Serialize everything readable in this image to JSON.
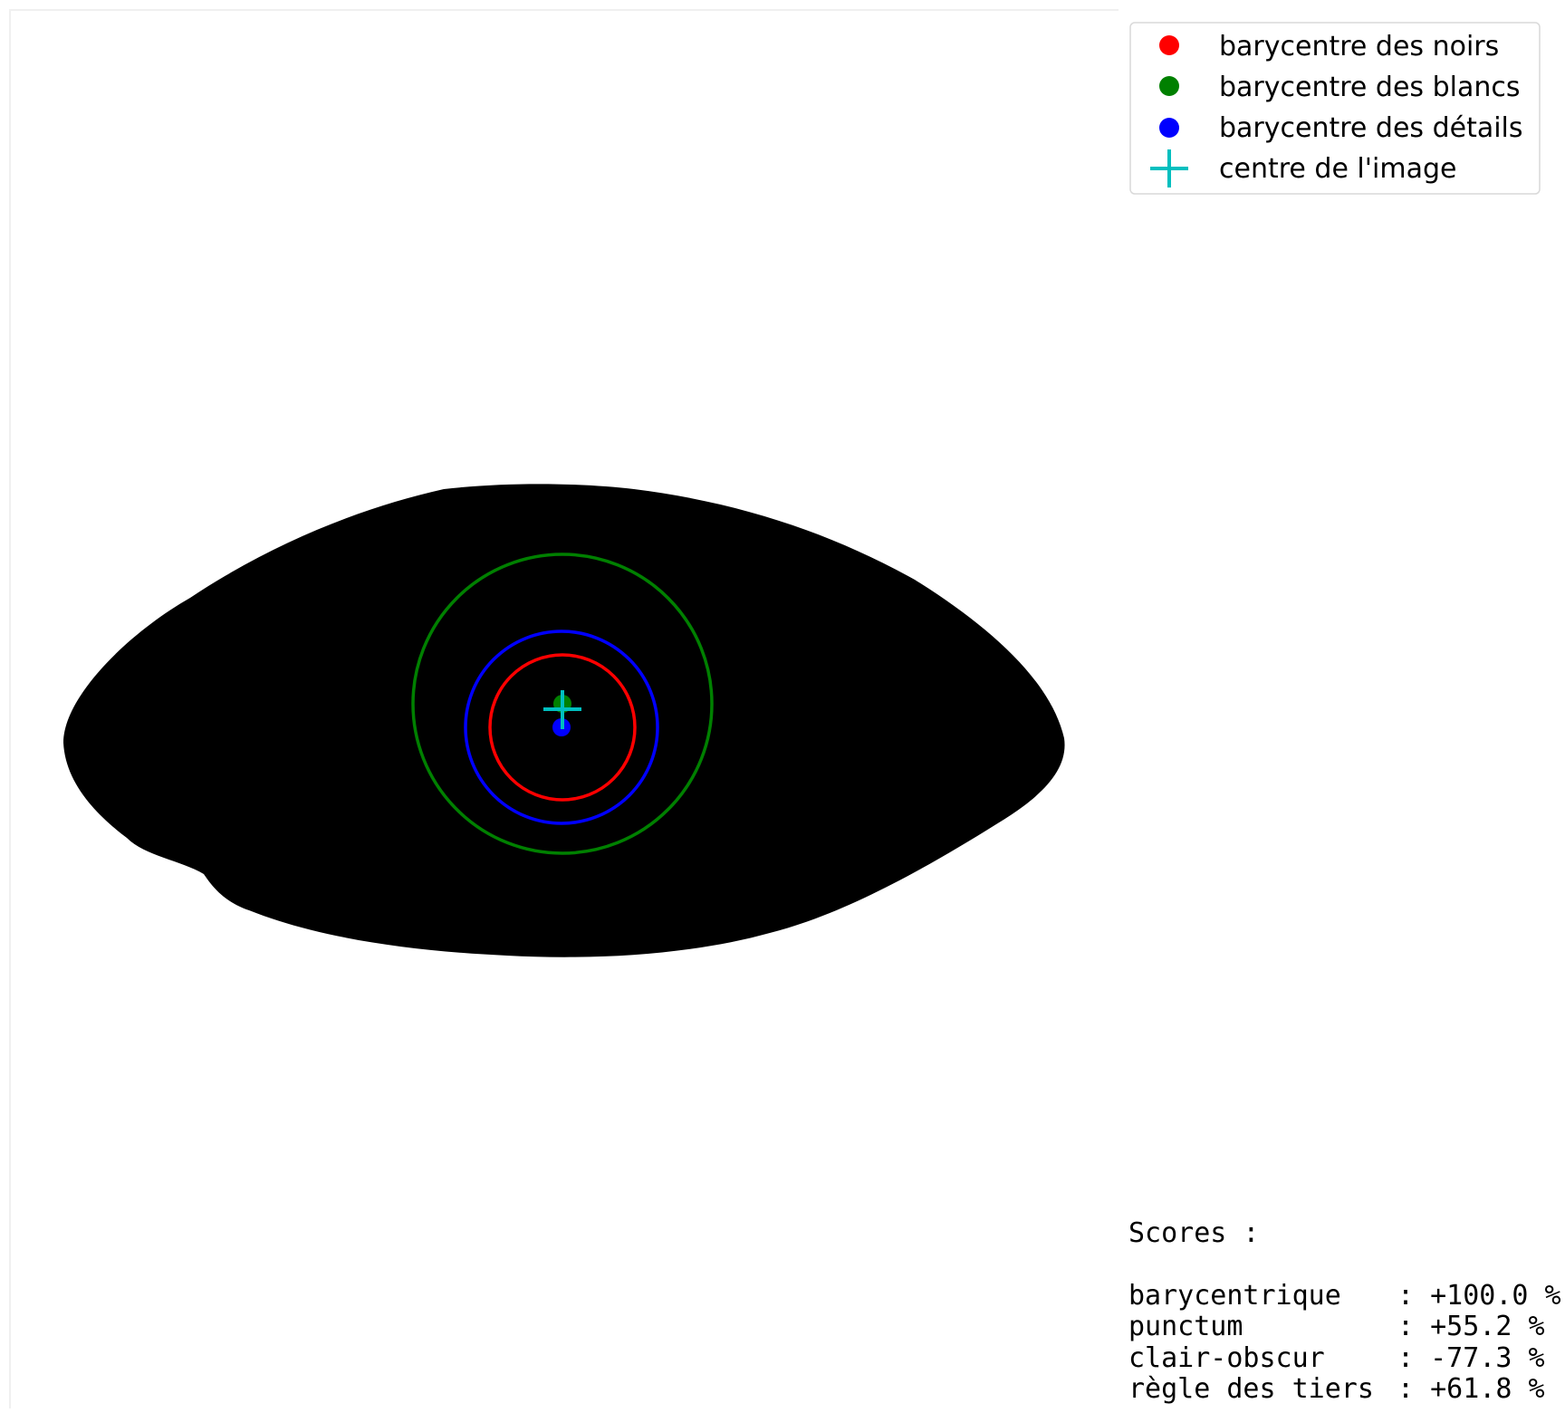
{
  "legend": {
    "items": [
      {
        "label": "barycentre des noirs",
        "marker": "dot",
        "color": "#ff0000"
      },
      {
        "label": "barycentre des blancs",
        "marker": "dot",
        "color": "#008000"
      },
      {
        "label": "barycentre des détails",
        "marker": "dot",
        "color": "#0000ff"
      },
      {
        "label": "centre de l'image",
        "marker": "plus",
        "color": "#00bfbf"
      }
    ]
  },
  "scores": {
    "heading": "Scores :",
    "rows": [
      {
        "name": "barycentrique  ",
        "value": ": +100.0 %"
      },
      {
        "name": "punctum        ",
        "value": ": +55.2 %"
      },
      {
        "name": "clair-obscur   ",
        "value": ": -77.3 %"
      },
      {
        "name": "règle des tiers",
        "value": ": +61.8 %"
      }
    ]
  },
  "colors": {
    "shape": "#000000",
    "noirs": "#ff0000",
    "blancs": "#008000",
    "details": "#0000ff",
    "centre": "#00bfbf"
  }
}
